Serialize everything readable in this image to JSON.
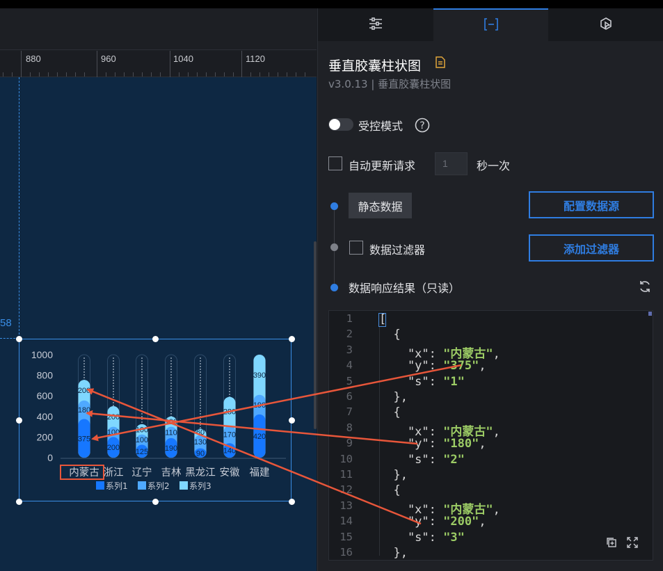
{
  "ruler": {
    "labels": [
      "880",
      "960",
      "1040",
      "1120"
    ]
  },
  "guide": {
    "value": "58"
  },
  "chart_data": {
    "type": "bar",
    "categories": [
      "内蒙古",
      "浙江",
      "辽宁",
      "吉林",
      "黑龙江",
      "安徽",
      "福建"
    ],
    "series": [
      {
        "name": "系列1",
        "values": [
          375,
          200,
          125,
          190,
          90,
          140,
          420
        ]
      },
      {
        "name": "系列2",
        "values": [
          180,
          100,
          100,
          110,
          130,
          170,
          190
        ]
      },
      {
        "name": "系列3",
        "values": [
          200,
          200,
          100,
          100,
          60,
          280,
          390
        ]
      }
    ],
    "ylim": [
      0,
      1000
    ],
    "yticks": [
      "0",
      "200",
      "400",
      "600",
      "800",
      "1000"
    ],
    "colors": [
      "#1677ff",
      "#4fa9ff",
      "#7fd7ff"
    ],
    "legend": "bottom"
  },
  "panel": {
    "tabs": [
      {
        "icon": "sliders-icon"
      },
      {
        "icon": "bracket-icon"
      },
      {
        "icon": "cursor-icon"
      }
    ],
    "title": "垂直胶囊柱状图",
    "version": "v3.0.13 | 垂直胶囊柱状图",
    "controlled_mode": "受控模式",
    "auto_update": "自动更新请求",
    "interval_value": "1",
    "interval_unit": "秒一次",
    "static_data": "静态数据",
    "configure_source": "配置数据源",
    "data_filter": "数据过滤器",
    "add_filter": "添加过滤器",
    "response_result": "数据响应结果（只读）"
  },
  "code": {
    "line_numbers": [
      "1",
      "2",
      "3",
      "4",
      "5",
      "6",
      "7",
      "8",
      "9",
      "10",
      "11",
      "12",
      "13",
      "14",
      "15",
      "16"
    ],
    "lines": [
      "[",
      "  {",
      "    \"x\": \"内蒙古\",",
      "    \"y\": \"375\",",
      "    \"s\": \"1\"",
      "  },",
      "  {",
      "    \"x\": \"内蒙古\",",
      "    \"y\": \"180\",",
      "    \"s\": \"2\"",
      "  },",
      "  {",
      "    \"x\": \"内蒙古\",",
      "    \"y\": \"200\",",
      "    \"s\": \"3\"",
      "  },"
    ]
  },
  "colors": {
    "accent": "#2f7de1",
    "annotation": "#e8563a",
    "stage_bg": "#0e2843"
  }
}
